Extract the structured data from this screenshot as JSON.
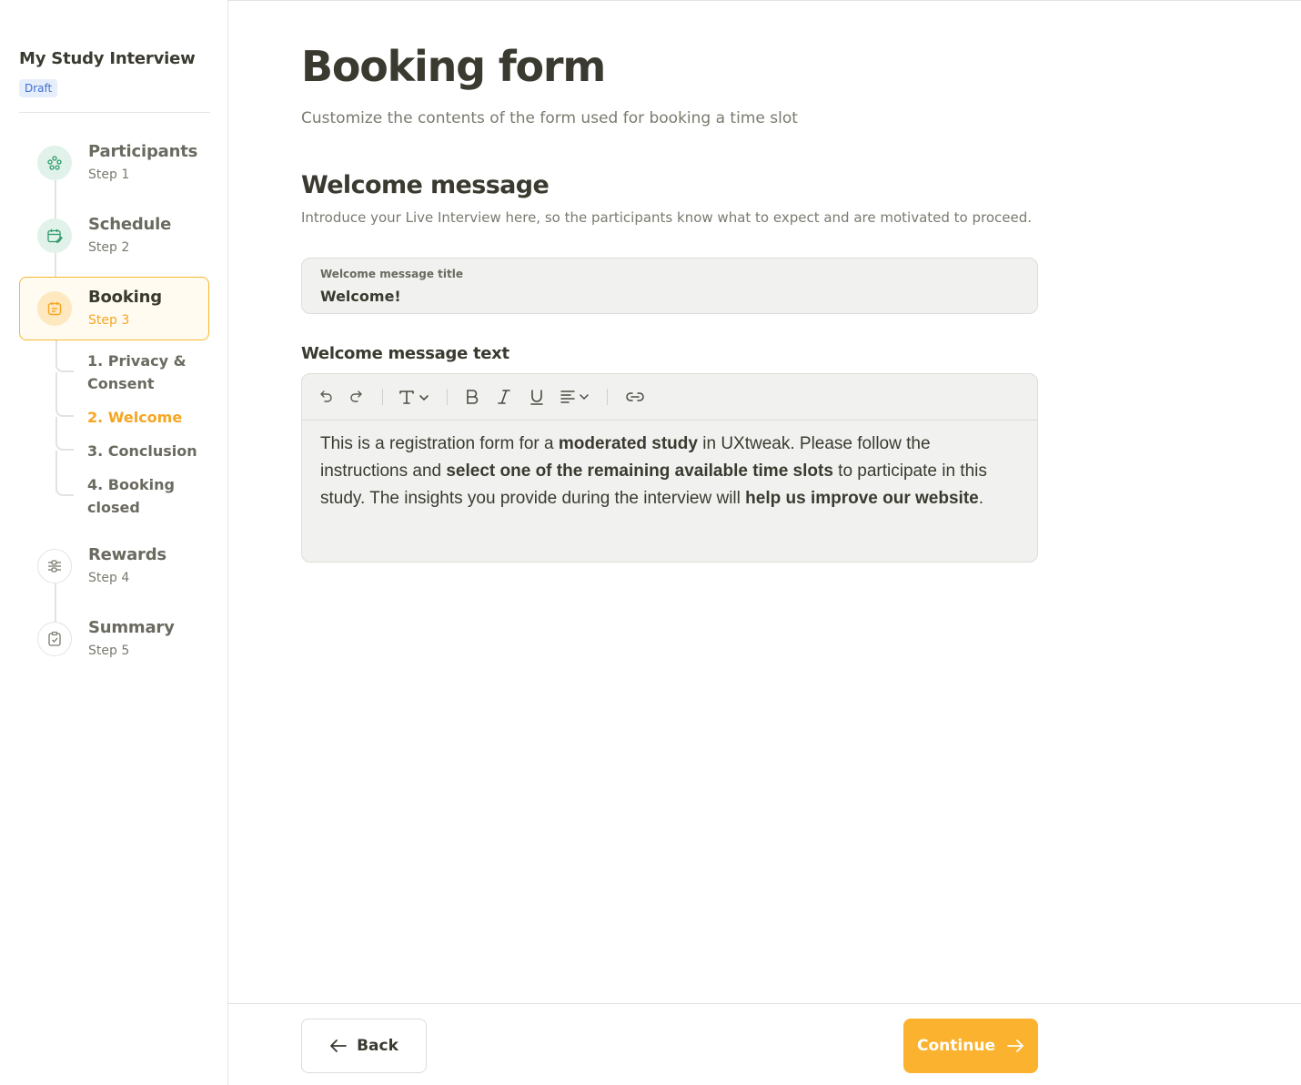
{
  "sidebar": {
    "study_title": "My Study Interview",
    "status_badge": "Draft",
    "steps": [
      {
        "label": "Participants",
        "sub": "Step 1",
        "icon": "participants-icon",
        "state": "done"
      },
      {
        "label": "Schedule",
        "sub": "Step 2",
        "icon": "calendar-edit-icon",
        "state": "done"
      },
      {
        "label": "Booking",
        "sub": "Step 3",
        "icon": "booking-calendar-icon",
        "state": "active"
      },
      {
        "label": "Rewards",
        "sub": "Step 4",
        "icon": "sliders-icon",
        "state": "todo"
      },
      {
        "label": "Summary",
        "sub": "Step 5",
        "icon": "clipboard-check-icon",
        "state": "todo"
      }
    ],
    "substeps": [
      {
        "label": "1. Privacy & Consent"
      },
      {
        "label": "2. Welcome",
        "current": true
      },
      {
        "label": "3. Conclusion"
      },
      {
        "label": "4. Booking closed"
      }
    ]
  },
  "main": {
    "title": "Booking form",
    "subtitle": "Customize the contents of the form used for booking a time slot",
    "section_title": "Welcome message",
    "section_desc": "Introduce your Live Interview here, so the participants know what to expect and are motivated to proceed.",
    "title_field": {
      "label": "Welcome message title",
      "value": "Welcome!"
    },
    "editor": {
      "label": "Welcome message text",
      "toolbar": [
        "undo-icon",
        "redo-icon",
        "text-style-icon",
        "bold-icon",
        "italic-icon",
        "underline-icon",
        "align-icon",
        "link-icon"
      ],
      "segments": [
        {
          "text": "This is a registration form for a ",
          "bold": false
        },
        {
          "text": "moderated study",
          "bold": true
        },
        {
          "text": " in UXtweak. Please follow the instructions and ",
          "bold": false
        },
        {
          "text": "select one of the remaining available time slots",
          "bold": true
        },
        {
          "text": " to participate in this study. The insights you provide during the interview will ",
          "bold": false
        },
        {
          "text": "help us improve our website",
          "bold": true
        },
        {
          "text": ".",
          "bold": false
        }
      ]
    }
  },
  "footer": {
    "back_label": "Back",
    "continue_label": "Continue"
  },
  "colors": {
    "accent": "#fbb32f",
    "accent_text": "#f5a623",
    "done_circle": "#e1f2ea",
    "done_icon": "#2e9a6a",
    "badge_bg": "#e6eefb",
    "badge_text": "#3f6fd1"
  }
}
